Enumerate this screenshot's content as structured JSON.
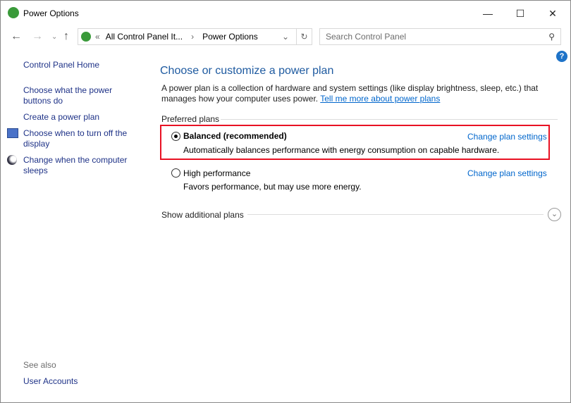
{
  "window": {
    "title": "Power Options"
  },
  "address": {
    "prefix": "«",
    "crumb1": "All Control Panel It...",
    "sep": "›",
    "crumb2": "Power Options"
  },
  "search": {
    "placeholder": "Search Control Panel"
  },
  "sidebar": {
    "items": [
      {
        "label": "Control Panel Home"
      },
      {
        "label": "Choose what the power buttons do"
      },
      {
        "label": "Create a power plan"
      },
      {
        "label": "Choose when to turn off the display"
      },
      {
        "label": "Change when the computer sleeps"
      }
    ],
    "see_also": "See also",
    "user_accounts": "User Accounts"
  },
  "main": {
    "title": "Choose or customize a power plan",
    "desc": "A power plan is a collection of hardware and system settings (like display brightness, sleep, etc.) that manages how your computer uses power.",
    "learn_more": "Tell me more about power plans",
    "preferred": "Preferred plans",
    "plans": [
      {
        "name": "Balanced (recommended)",
        "desc": "Automatically balances performance with energy consumption on capable hardware.",
        "change": "Change plan settings",
        "selected": true
      },
      {
        "name": "High performance",
        "desc": "Favors performance, but may use more energy.",
        "change": "Change plan settings",
        "selected": false
      }
    ],
    "additional": "Show additional plans"
  },
  "colors": {
    "highlight": "#e81123",
    "link": "#0066cc"
  }
}
